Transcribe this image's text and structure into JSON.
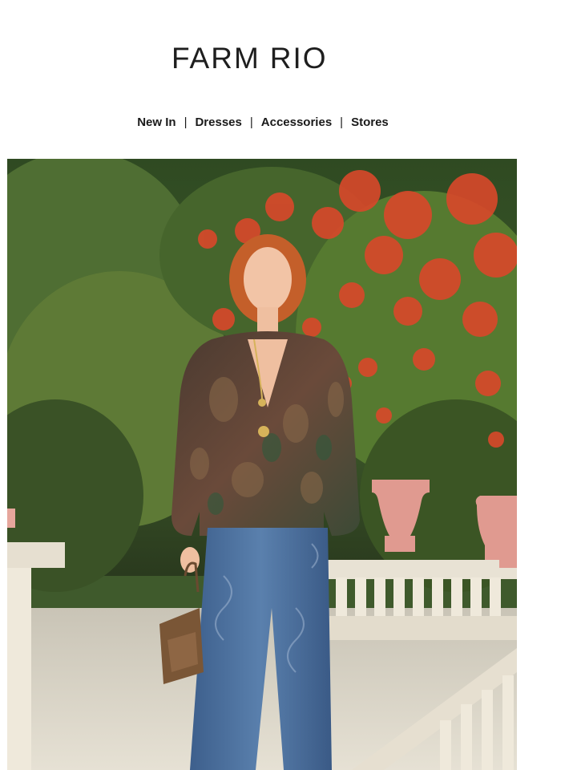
{
  "brand": {
    "name_part1": "FARM",
    "name_part2": "RIO"
  },
  "nav": {
    "items": [
      {
        "label": "New In"
      },
      {
        "label": "Dresses"
      },
      {
        "label": "Accessories"
      },
      {
        "label": "Stores"
      }
    ],
    "separator": "|"
  },
  "colors": {
    "text": "#1a1a1a",
    "background": "#ffffff"
  }
}
